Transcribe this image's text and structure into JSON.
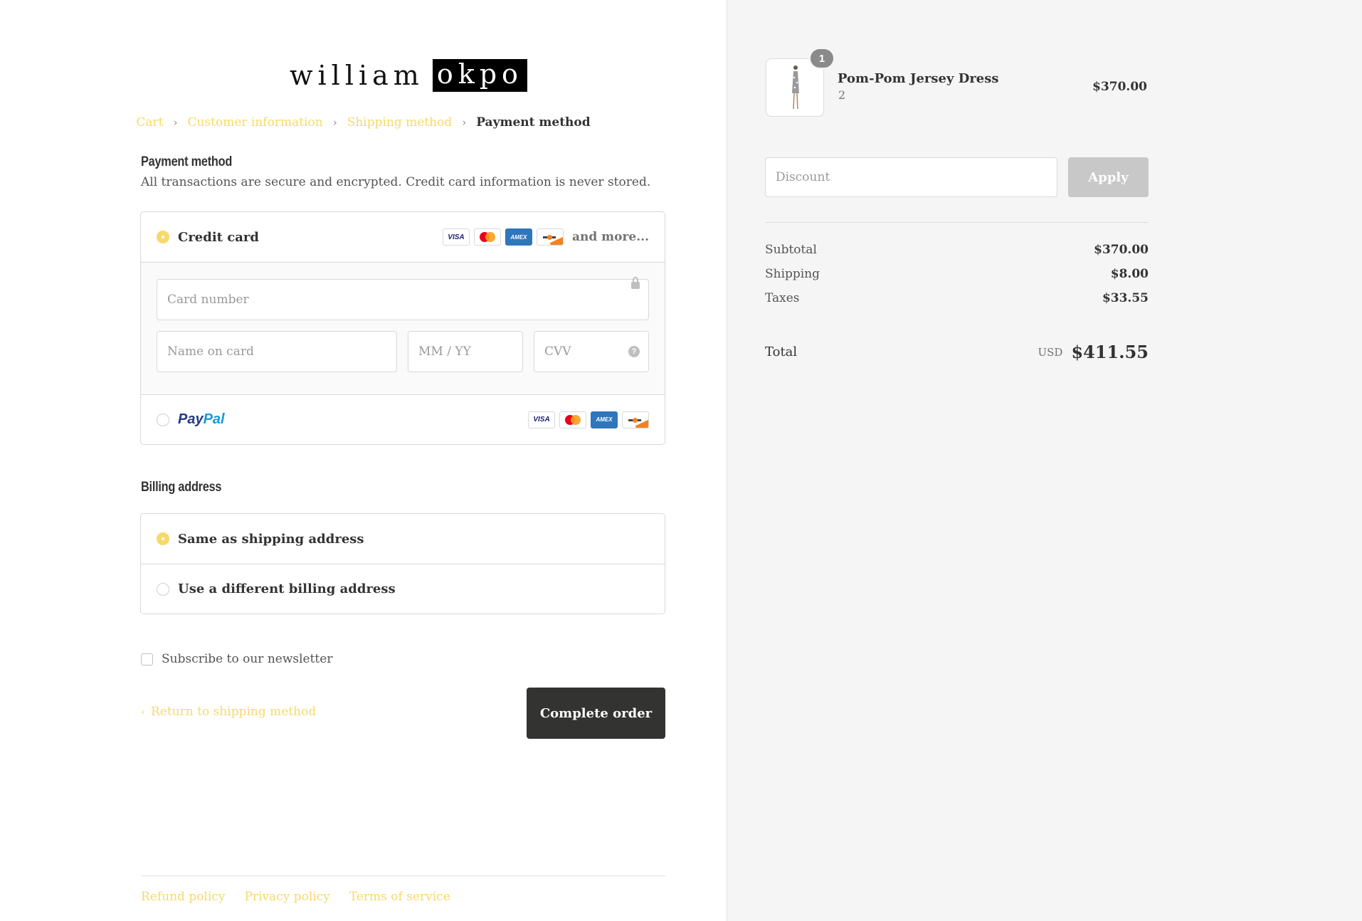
{
  "brand": {
    "part1": "william",
    "part2": "okpo"
  },
  "breadcrumb": {
    "items": [
      "Cart",
      "Customer information",
      "Shipping method",
      "Payment method"
    ],
    "separator": "›"
  },
  "payment": {
    "title": "Payment method",
    "subtitle": "All transactions are secure and encrypted. Credit card information is never stored.",
    "credit_card_label": "Credit card",
    "and_more": "and more...",
    "card_number_placeholder": "Card number",
    "name_placeholder": "Name on card",
    "expiry_placeholder": "MM / YY",
    "cvv_placeholder": "CVV",
    "cvv_help": "?",
    "paypal_part1": "Pay",
    "paypal_part2": "Pal",
    "card_brands": [
      "visa",
      "mastercard",
      "amex",
      "discover"
    ],
    "visa_text": "VISA",
    "amex_text": "AMEX",
    "selected": "credit-card"
  },
  "billing": {
    "title": "Billing address",
    "same_label": "Same as shipping address",
    "different_label": "Use a different billing address",
    "selected": "same"
  },
  "newsletter": {
    "label": "Subscribe to our newsletter",
    "checked": false
  },
  "nav": {
    "return_chevron": "‹",
    "return_label": "Return to shipping method",
    "complete_label": "Complete order"
  },
  "footer": {
    "links": [
      "Refund policy",
      "Privacy policy",
      "Terms of service"
    ]
  },
  "order": {
    "quantity_badge": "1",
    "product_name": "Pom-Pom Jersey Dress",
    "product_variant": "2",
    "product_price": "$370.00",
    "discount_placeholder": "Discount",
    "apply_label": "Apply",
    "subtotal_label": "Subtotal",
    "subtotal_value": "$370.00",
    "shipping_label": "Shipping",
    "shipping_value": "$8.00",
    "taxes_label": "Taxes",
    "taxes_value": "$33.55",
    "total_label": "Total",
    "currency": "USD",
    "total_value": "$411.55"
  },
  "colors": {
    "accent": "#f7d96b",
    "button_dark": "#333431",
    "sidebar_bg": "#f5f5f5"
  }
}
